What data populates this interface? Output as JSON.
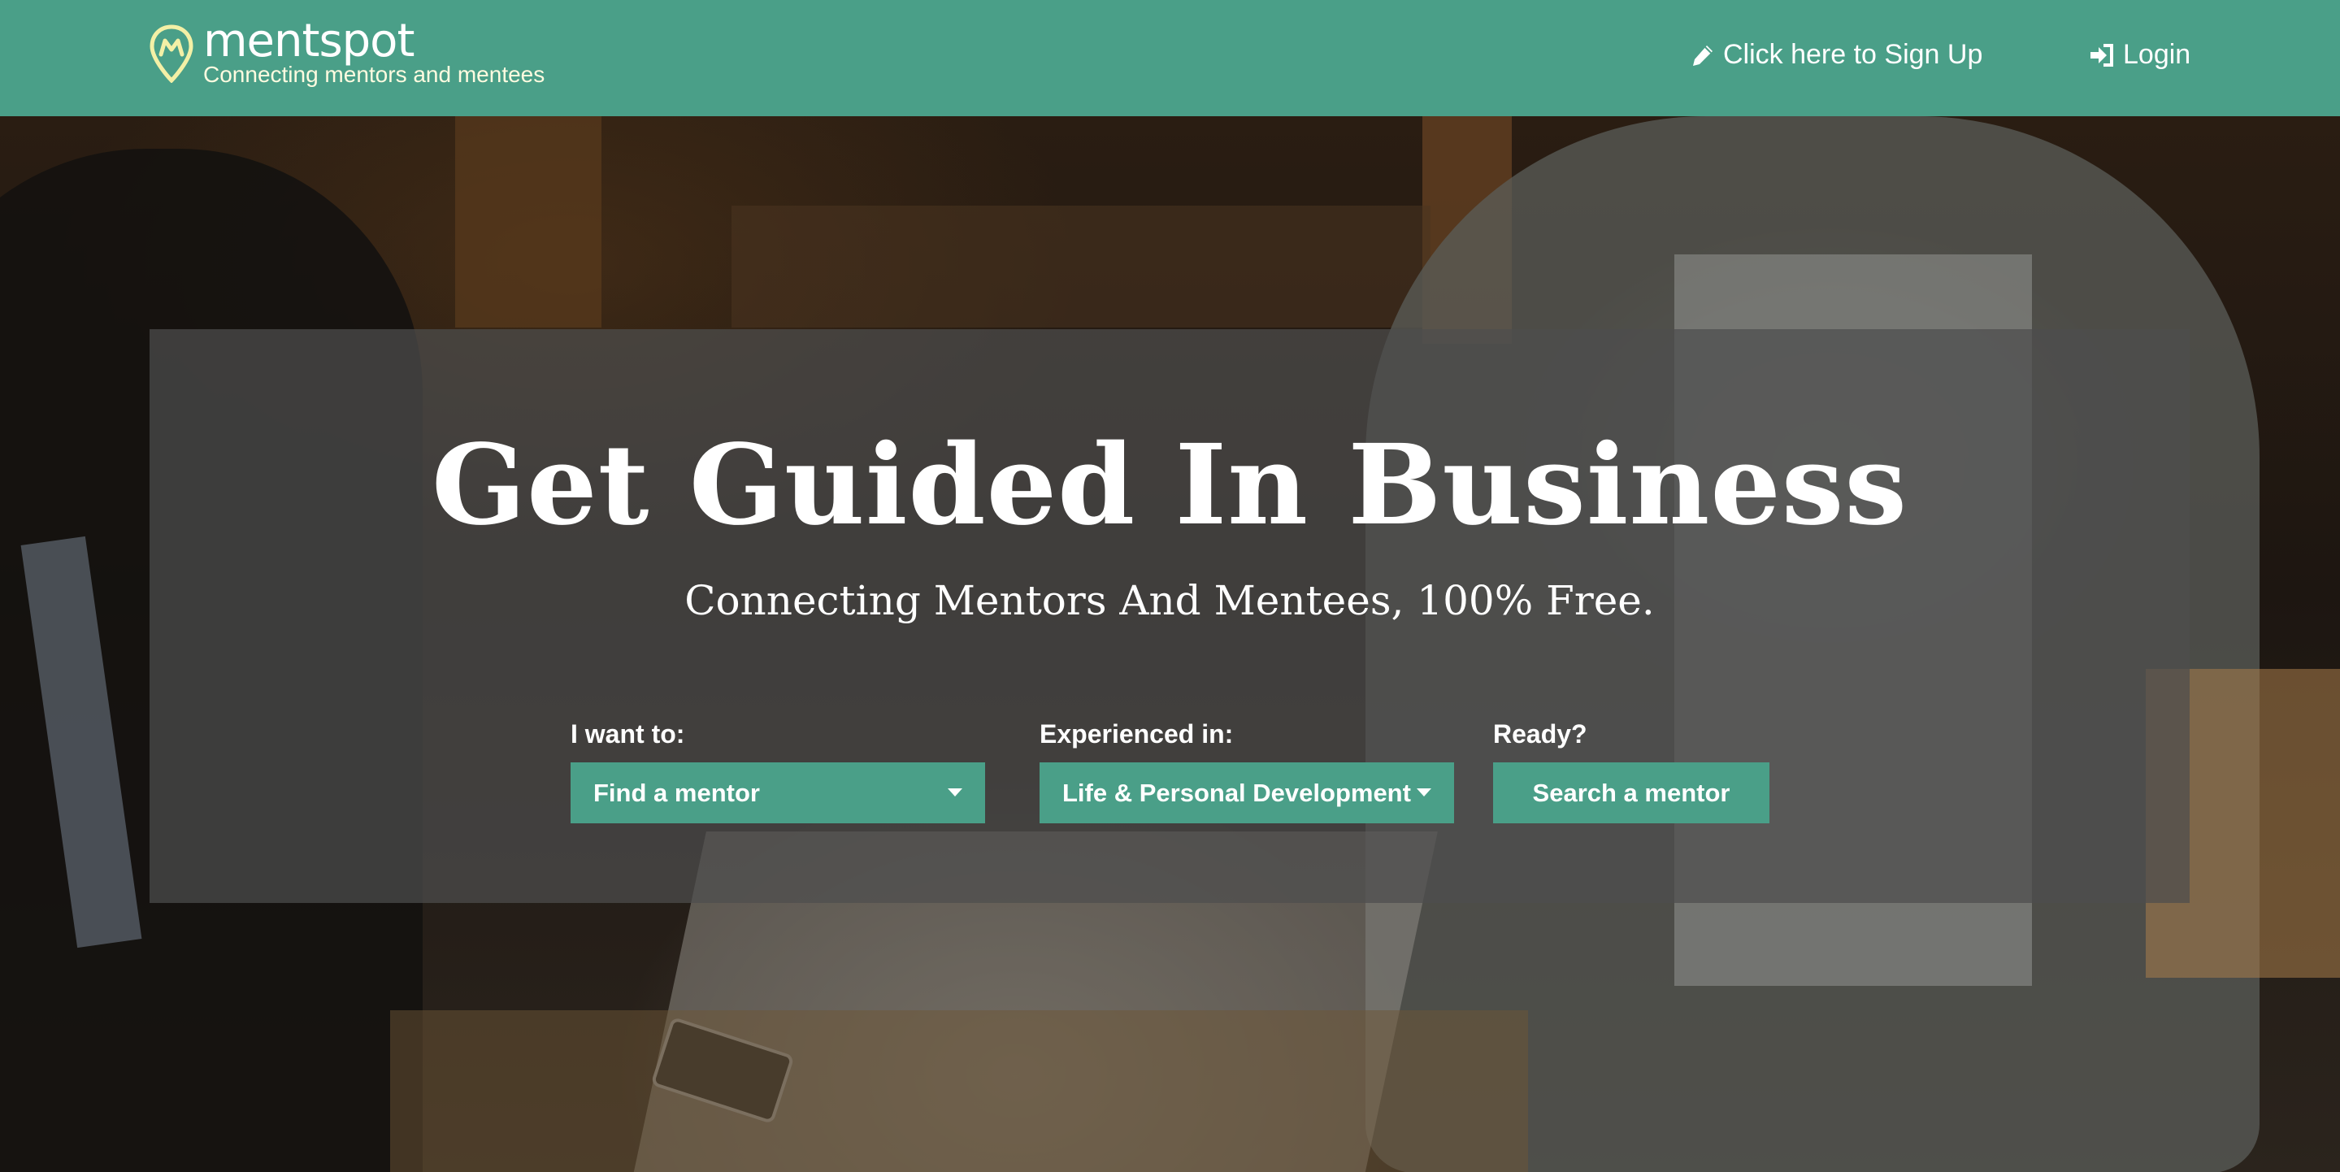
{
  "header": {
    "brand_name": "mentspot",
    "brand_tagline": "Connecting mentors and mentees",
    "signup_label": "Click here to Sign Up",
    "login_label": "Login"
  },
  "hero": {
    "title": "Get Guided In Business",
    "subtitle": "Connecting Mentors And Mentees, 100% Free."
  },
  "form": {
    "want_label": "I want to:",
    "want_value": "Find a mentor",
    "experience_label": "Experienced in:",
    "experience_value": "Life & Personal Development",
    "ready_label": "Ready?",
    "search_label": "Search a mentor"
  },
  "icons": {
    "logo": "map-pin-logo-icon",
    "signup": "pencil-icon",
    "login": "sign-in-icon",
    "dropdown": "caret-down-icon"
  },
  "colors": {
    "brand_green": "#4a9f88",
    "logo_yellow": "#f3f0a6",
    "panel_overlay": "rgba(78,78,78,0.72)",
    "text_white": "#ffffff"
  }
}
